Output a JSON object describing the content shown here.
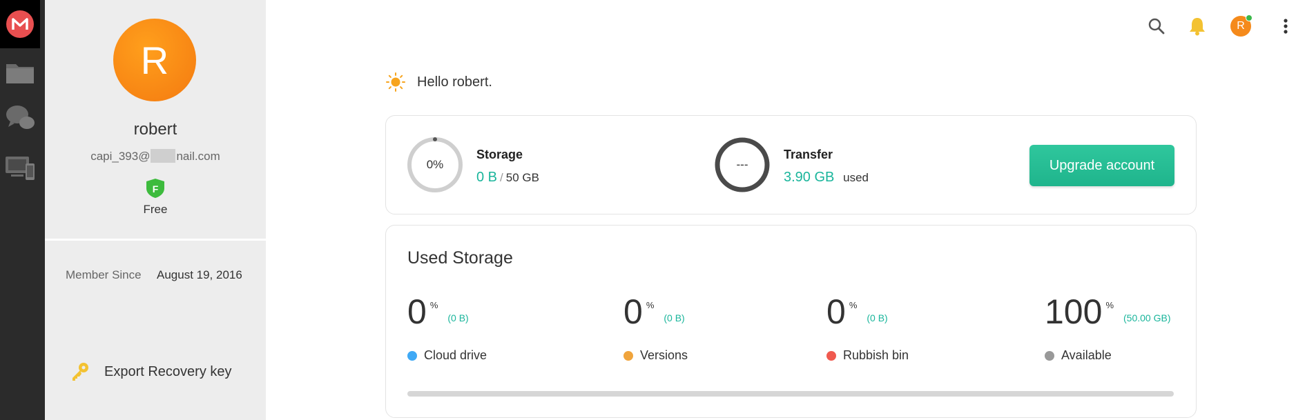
{
  "app": {
    "name": "MEGA"
  },
  "profile": {
    "avatar_initial": "R",
    "name": "robert",
    "email_start": "capi_393@",
    "email_end": "nail.com",
    "plan_badge": "F",
    "plan": "Free",
    "member_since_label": "Member Since",
    "member_since_value": "August 19, 2016",
    "export_label": "Export Recovery key"
  },
  "topbar": {
    "avatar_initial": "R"
  },
  "greeting": "Hello robert.",
  "summary": {
    "storage": {
      "ring_text": "0%",
      "title": "Storage",
      "used": "0 B",
      "separator": "/",
      "total": "50 GB",
      "fraction": 0.0
    },
    "transfer": {
      "ring_text": "---",
      "title": "Transfer",
      "used": "3.90 GB",
      "suffix": "used"
    },
    "upgrade_label": "Upgrade account"
  },
  "used_storage": {
    "title": "Used Storage",
    "items": [
      {
        "value": "0",
        "unit": "%",
        "size": "(0 B)",
        "label": "Cloud drive",
        "color": "#3fa9f5"
      },
      {
        "value": "0",
        "unit": "%",
        "size": "(0 B)",
        "label": "Versions",
        "color": "#f0a43c"
      },
      {
        "value": "0",
        "unit": "%",
        "size": "(0 B)",
        "label": "Rubbish bin",
        "color": "#f05a4f"
      },
      {
        "value": "100",
        "unit": "%",
        "size": "(50.00 GB)",
        "label": "Available",
        "color": "#999999"
      }
    ]
  },
  "colors": {
    "accent": "#19b59b",
    "upgrade": "#22b98f",
    "avatar": "#f58a1b"
  }
}
